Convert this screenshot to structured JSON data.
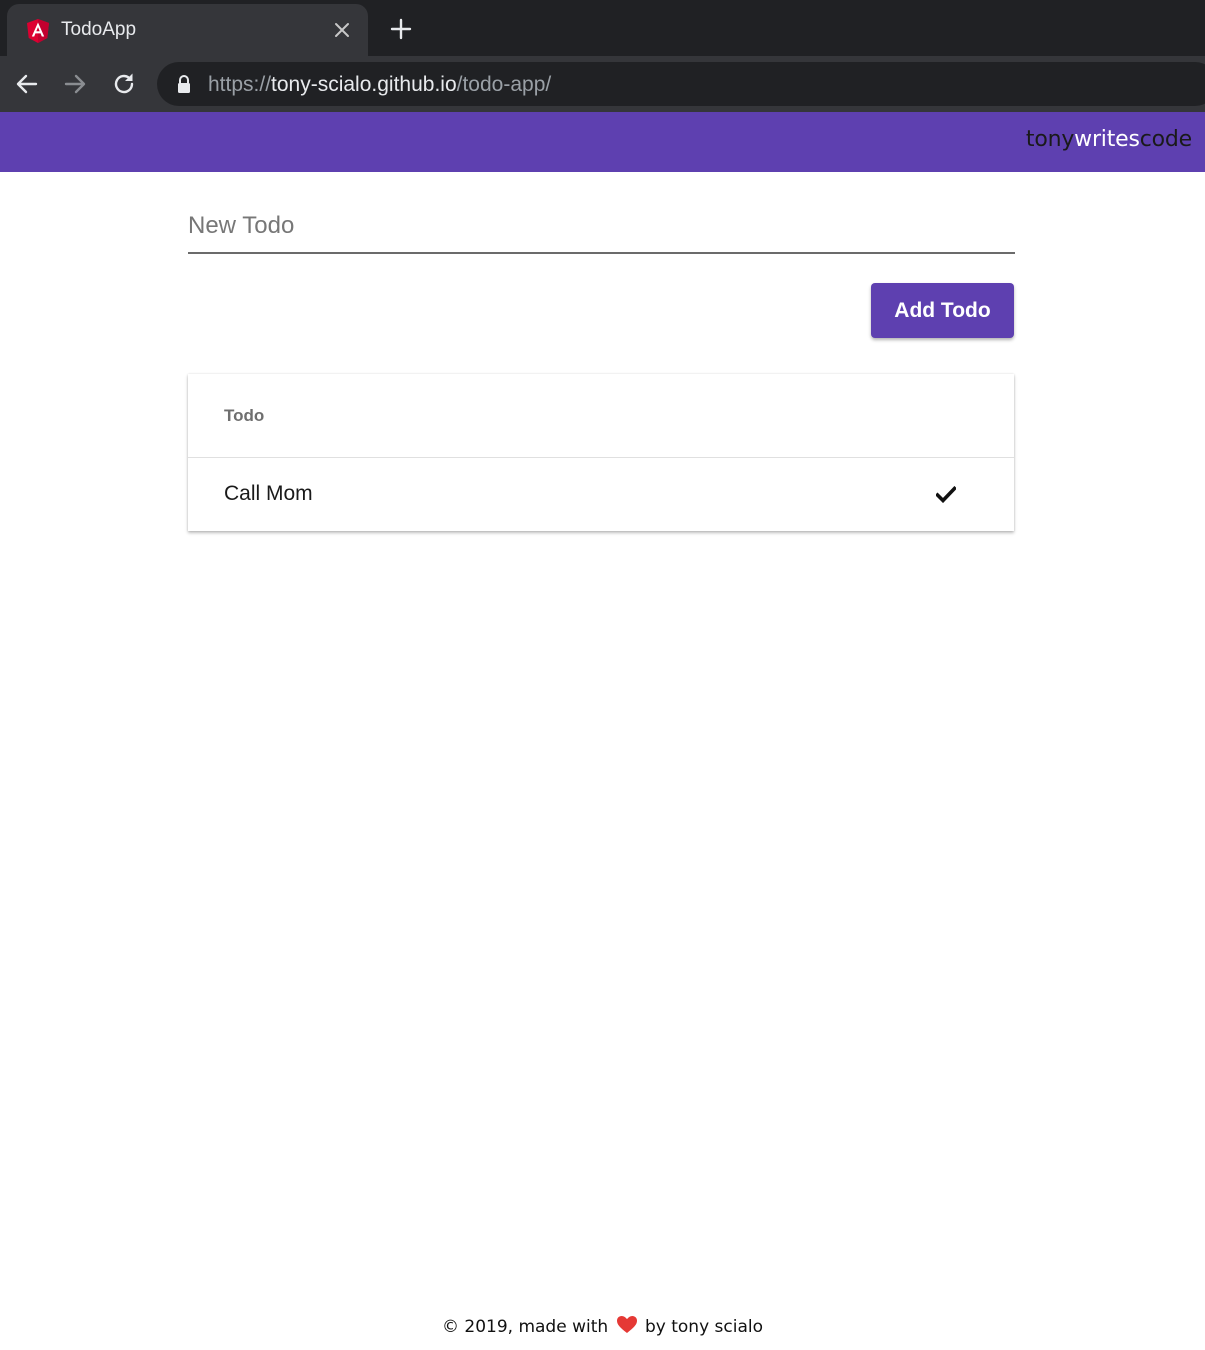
{
  "browser": {
    "tab_title": "TodoApp",
    "url_scheme": "https://",
    "url_host": "tony-scialo.github.io",
    "url_path": "/todo-app/"
  },
  "header": {
    "brand_part1": "tony",
    "brand_part2": "writes",
    "brand_part3": "code",
    "color": "#5e40b0"
  },
  "form": {
    "input_placeholder": "New Todo",
    "input_value": "",
    "add_button_label": "Add Todo"
  },
  "todo_list": {
    "header_label": "Todo",
    "items": [
      {
        "text": "Call Mom",
        "action_icon": "check-icon"
      }
    ]
  },
  "footer": {
    "text_before": "© 2019, made with",
    "text_after": "by tony scialo",
    "heart_color": "#e53935"
  }
}
